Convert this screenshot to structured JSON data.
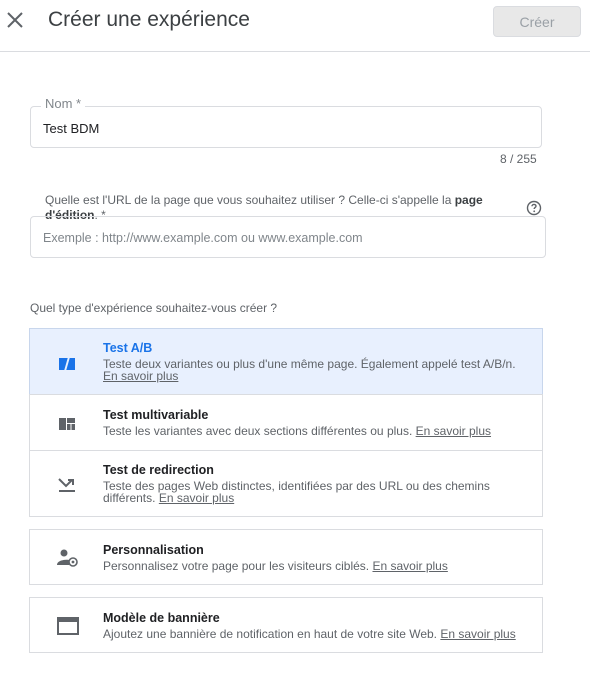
{
  "header": {
    "title": "Créer une expérience",
    "create_label": "Créer"
  },
  "name_field": {
    "label": "Nom *",
    "value": "Test BDM",
    "counter": "8 / 255"
  },
  "url_field": {
    "label_text": "Quelle est l'URL de la page que vous souhaitez utiliser ? Celle-ci s'appelle la ",
    "label_bold": "page d'édition",
    "label_suffix": ". *",
    "placeholder": "Exemple : http://www.example.com ou www.example.com"
  },
  "experience_type": {
    "question": "Quel type d'expérience souhaitez-vous créer ?",
    "options": [
      {
        "title": "Test A/B",
        "description": "Teste deux variantes ou plus d'une même page. Également appelé test A/B/n.",
        "link": "En savoir plus",
        "icon": "ab-test-icon",
        "selected": true
      },
      {
        "title": "Test multivariable",
        "description": "Teste les variantes avec deux sections différentes ou plus.",
        "link": "En savoir plus",
        "icon": "multivariate-icon",
        "selected": false
      },
      {
        "title": "Test de redirection",
        "description": "Teste des pages Web distinctes, identifiées par des URL ou des chemins différents.",
        "link": "En savoir plus",
        "icon": "redirect-icon",
        "selected": false
      },
      {
        "title": "Personnalisation",
        "description": "Personnalisez votre page pour les visiteurs ciblés.",
        "link": "En savoir plus",
        "icon": "personalization-icon",
        "selected": false
      },
      {
        "title": "Modèle de bannière",
        "description": "Ajoutez une bannière de notification en haut de votre site Web.",
        "link": "En savoir plus",
        "icon": "banner-icon",
        "selected": false
      }
    ]
  },
  "colors": {
    "accent": "#1a73e8",
    "selected_bg": "#e8f0fe",
    "border": "#dadce0",
    "icon": "#5f6368"
  }
}
